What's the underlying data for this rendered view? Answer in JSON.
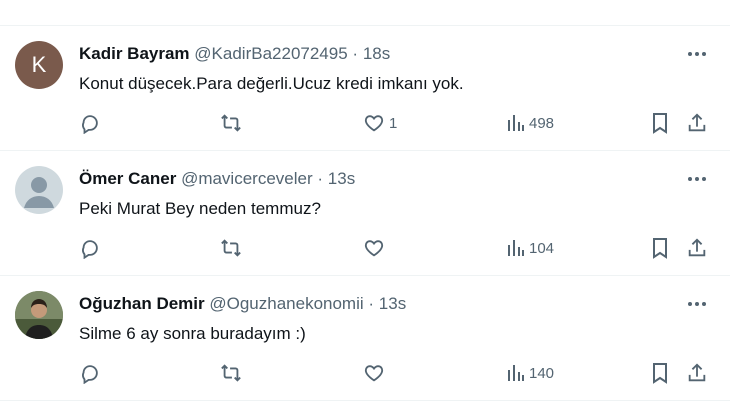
{
  "tweets": [
    {
      "name": "Kadir Bayram",
      "handle": "@KadirBa22072495",
      "separator": "·",
      "time": "18s",
      "text": "Konut düşecek.Para değerli.Ucuz kredi imkanı yok.",
      "avatar_letter": "K",
      "likes": "1",
      "views": "498"
    },
    {
      "name": "Ömer Caner",
      "handle": "@mavicerceveler",
      "separator": "·",
      "time": "13s",
      "text": "Peki Murat Bey neden temmuz?",
      "likes": "",
      "views": "104"
    },
    {
      "name": "Oğuzhan Demir",
      "handle": "@Oguzhanekonomii",
      "separator": "·",
      "time": "13s",
      "text": "Silme 6 ay sonra buradayım :)",
      "likes": "",
      "views": "140"
    }
  ],
  "icons": {
    "reply": "reply-icon",
    "repost": "repost-icon",
    "like": "heart-icon",
    "views": "views-icon",
    "bookmark": "bookmark-icon",
    "share": "share-icon",
    "more": "more-icon"
  },
  "colors": {
    "text_primary": "#0f1419",
    "text_secondary": "#536471",
    "divider": "#eff3f4"
  }
}
